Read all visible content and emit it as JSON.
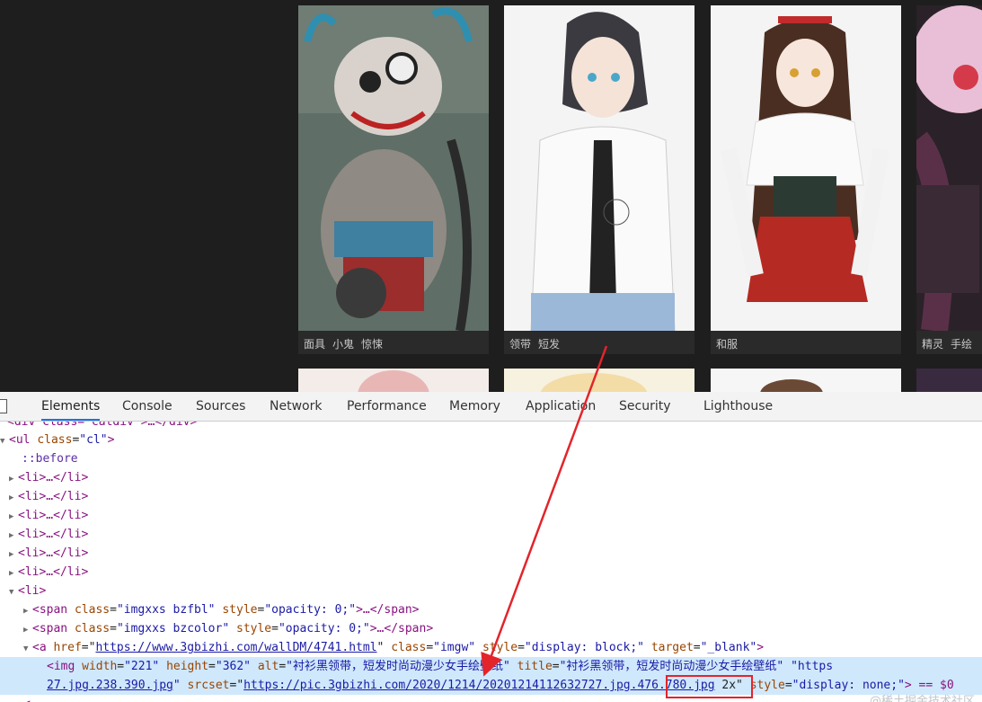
{
  "gallery": {
    "cards": [
      {
        "tags": [
          "面具",
          "小鬼",
          "惊悚"
        ]
      },
      {
        "tags": [
          "领带",
          "短发"
        ]
      },
      {
        "tags": [
          "和服"
        ]
      },
      {
        "tags": [
          "精灵",
          "手绘"
        ]
      }
    ]
  },
  "devtools": {
    "tabs": [
      "Elements",
      "Console",
      "Sources",
      "Network",
      "Performance",
      "Memory",
      "Application",
      "Security",
      "Lighthouse"
    ],
    "active_tab": "Elements",
    "watermark": "@稀土掘金技术社区",
    "lines": {
      "l0": "<div class=\"catdiv\">…</div>",
      "ul_tag": "<ul",
      "ul_attr": "class",
      "ul_val": "\"cl\"",
      "before": "::before",
      "li": "<li>…</li>",
      "li_open": "<li>",
      "span1_attr1": "class",
      "span1_val1": "\"imgxxs bzfbl\"",
      "span2_val1": "\"imgxxs bzcolor\"",
      "style_attr": "style",
      "opacity_val": "\"opacity: 0;\"",
      "span_close": ">…</span>",
      "a_href_attr": "href",
      "a_href": "https://www.3gbizhi.com/wallDM/4741.html",
      "a_class_val": "\"imgw\"",
      "a_style_val": "\"display: block;\"",
      "a_target_attr": "target",
      "a_target_val": "\"_blank\"",
      "img_width_attr": "width",
      "img_width": "\"221\"",
      "img_height_attr": "height",
      "img_height": "\"362\"",
      "img_alt_attr": "alt",
      "img_alt": "\"衬衫黑领带，短发时尚动漫少女手绘壁纸\"",
      "img_title_attr": "title",
      "img_title": "\"衬衫黑领带，短发时尚动漫少女手绘壁纸\"",
      "img_data_tail": "\"https",
      "img_src_tail": "27.jpg.238.390.jpg",
      "srcset_attr": "srcset",
      "srcset_url": "https://pic.3gbizhi.com/2020/1214/20201214112632727.jpg.",
      "srcset_hl": "476.780.jpg",
      "srcset_rest": " 2x\"",
      "img_style_val": "\"display: none;\"",
      "img_close": "> == $0"
    }
  },
  "colors": {
    "arrow": "#e3242b",
    "selection": "#cfe8fc",
    "tag_purple": "#881280",
    "attr_brown": "#994500",
    "value_blue": "#1a1aa6"
  }
}
